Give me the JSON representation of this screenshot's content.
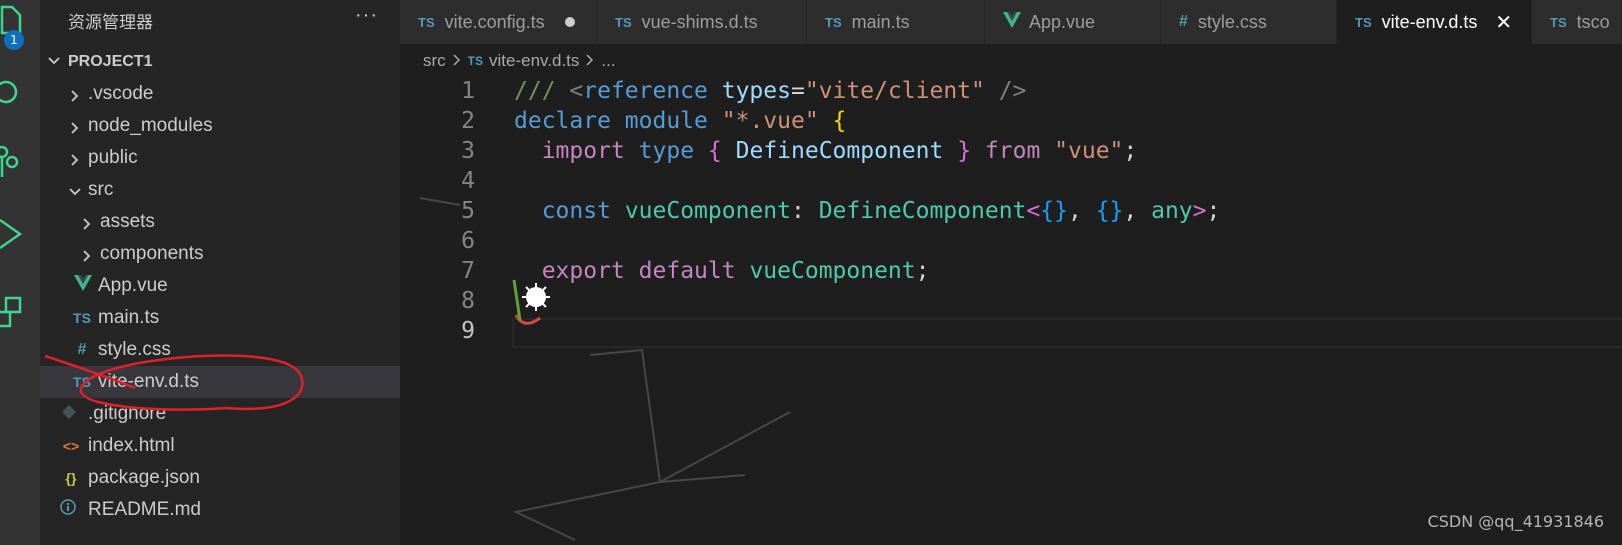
{
  "activity_bar": {
    "badge_count": "1",
    "icons": [
      "files-icon",
      "search-icon",
      "source-control-icon",
      "run-debug-icon",
      "extensions-icon"
    ]
  },
  "sidebar": {
    "title": "资源管理器",
    "more": "···",
    "project": "PROJECT1",
    "items": [
      {
        "label": ".vscode",
        "icon": "chevron-right"
      },
      {
        "label": "node_modules",
        "icon": "chevron-right"
      },
      {
        "label": "public",
        "icon": "chevron-right"
      },
      {
        "label": "src",
        "icon": "chevron-down"
      },
      {
        "label": "assets",
        "icon": "chevron-right"
      },
      {
        "label": "components",
        "icon": "chevron-right"
      },
      {
        "label": "App.vue",
        "icon": "vue-icon"
      },
      {
        "label": "main.ts",
        "icon": "ts-icon"
      },
      {
        "label": "style.css",
        "icon": "css-icon"
      },
      {
        "label": "vite-env.d.ts",
        "icon": "ts-icon"
      },
      {
        "label": ".gitignore",
        "icon": "git-icon"
      },
      {
        "label": "index.html",
        "icon": "html-icon"
      },
      {
        "label": "package.json",
        "icon": "json-icon"
      },
      {
        "label": "README.md",
        "icon": "info-icon"
      }
    ],
    "icon_labels": {
      "ts": "TS",
      "css": "#",
      "json": "{}",
      "html": "<>",
      "info": "i"
    }
  },
  "tabs": [
    {
      "label": "vite.config.ts",
      "icon": "TS"
    },
    {
      "label": "vue-shims.d.ts",
      "icon": "TS"
    },
    {
      "label": "main.ts",
      "icon": "TS"
    },
    {
      "label": "App.vue",
      "icon": "V"
    },
    {
      "label": "style.css",
      "icon": "#"
    },
    {
      "label": "vite-env.d.ts",
      "icon": "TS"
    },
    {
      "label": "tsco",
      "icon": "TS"
    }
  ],
  "tab_close": "✕",
  "breadcrumb": {
    "folder": "src",
    "file_icon": "TS",
    "file": "vite-env.d.ts",
    "tail": "..."
  },
  "line_numbers": [
    "1",
    "2",
    "3",
    "4",
    "5",
    "6",
    "7",
    "8",
    "9"
  ],
  "code": {
    "l1": {
      "comment": "/// ",
      "lt": "<",
      "tag": "reference",
      "attr": "types",
      "eq": "=",
      "str": "\"vite/client\"",
      "end": " />"
    },
    "l2": {
      "kw1": "declare",
      "kw2": "module",
      "str": "\"*.vue\"",
      "brace": "{"
    },
    "l3": {
      "kw1": "import",
      "kw2": "type",
      "ob": "{",
      "type": "DefineComponent",
      "cb": "}",
      "kw3": "from",
      "str": "\"vue\"",
      "semi": ";"
    },
    "l5": {
      "kw": "const",
      "var": "vueComponent",
      "colon": ": ",
      "type": "DefineComponent",
      "lt": "<",
      "o1": "{",
      "c1": "}",
      "comma1": ", ",
      "o2": "{",
      "c2": "}",
      "comma2": ", ",
      "any": "any",
      "gt": ">",
      "semi": ";"
    },
    "l7": {
      "kw1": "export",
      "kw2": "default",
      "var": "vueComponent",
      "semi": ";"
    }
  },
  "watermark": "CSDN @qq_41931846",
  "colors": {
    "accent": "#0e70c0",
    "annotation": "#e0202a"
  }
}
